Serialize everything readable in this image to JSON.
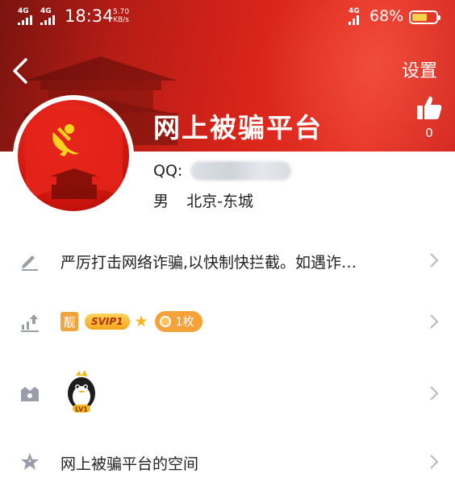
{
  "status_bar": {
    "signal_1_label": "4G",
    "signal_2_label": "4G",
    "time": "18:34",
    "speed_value": "5.70",
    "speed_unit": "KB/s",
    "network_label": "4G",
    "battery_percent": "68%",
    "battery_level": 0.68
  },
  "header": {
    "back_icon": "chevron-left-icon",
    "settings_label": "设置",
    "like_icon": "thumbs-up-icon",
    "like_count": "0",
    "nickname": "网上被骗平台"
  },
  "profile": {
    "qq_label": "QQ:",
    "gender": "男",
    "location": "北京-东城"
  },
  "rows": {
    "signature": {
      "icon": "edit-pencil-icon",
      "text": "严厉打击网络诈骗,以快制快拦截。如遇诈…"
    },
    "level": {
      "icon": "upload-level-icon",
      "jing_label": "靓",
      "svip_label": "SVIP1",
      "coin_label": "1枚"
    },
    "pet": {
      "icon": "gift-box-icon",
      "pet_label": "LV1"
    },
    "space": {
      "icon": "star-space-icon",
      "text": "网上被骗平台的空间"
    }
  },
  "colors": {
    "banner_red": "#d9241a",
    "badge_orange": "#f6a23a",
    "icon_gray": "#9a9ea8",
    "chevron_gray": "#b8bcc4"
  }
}
